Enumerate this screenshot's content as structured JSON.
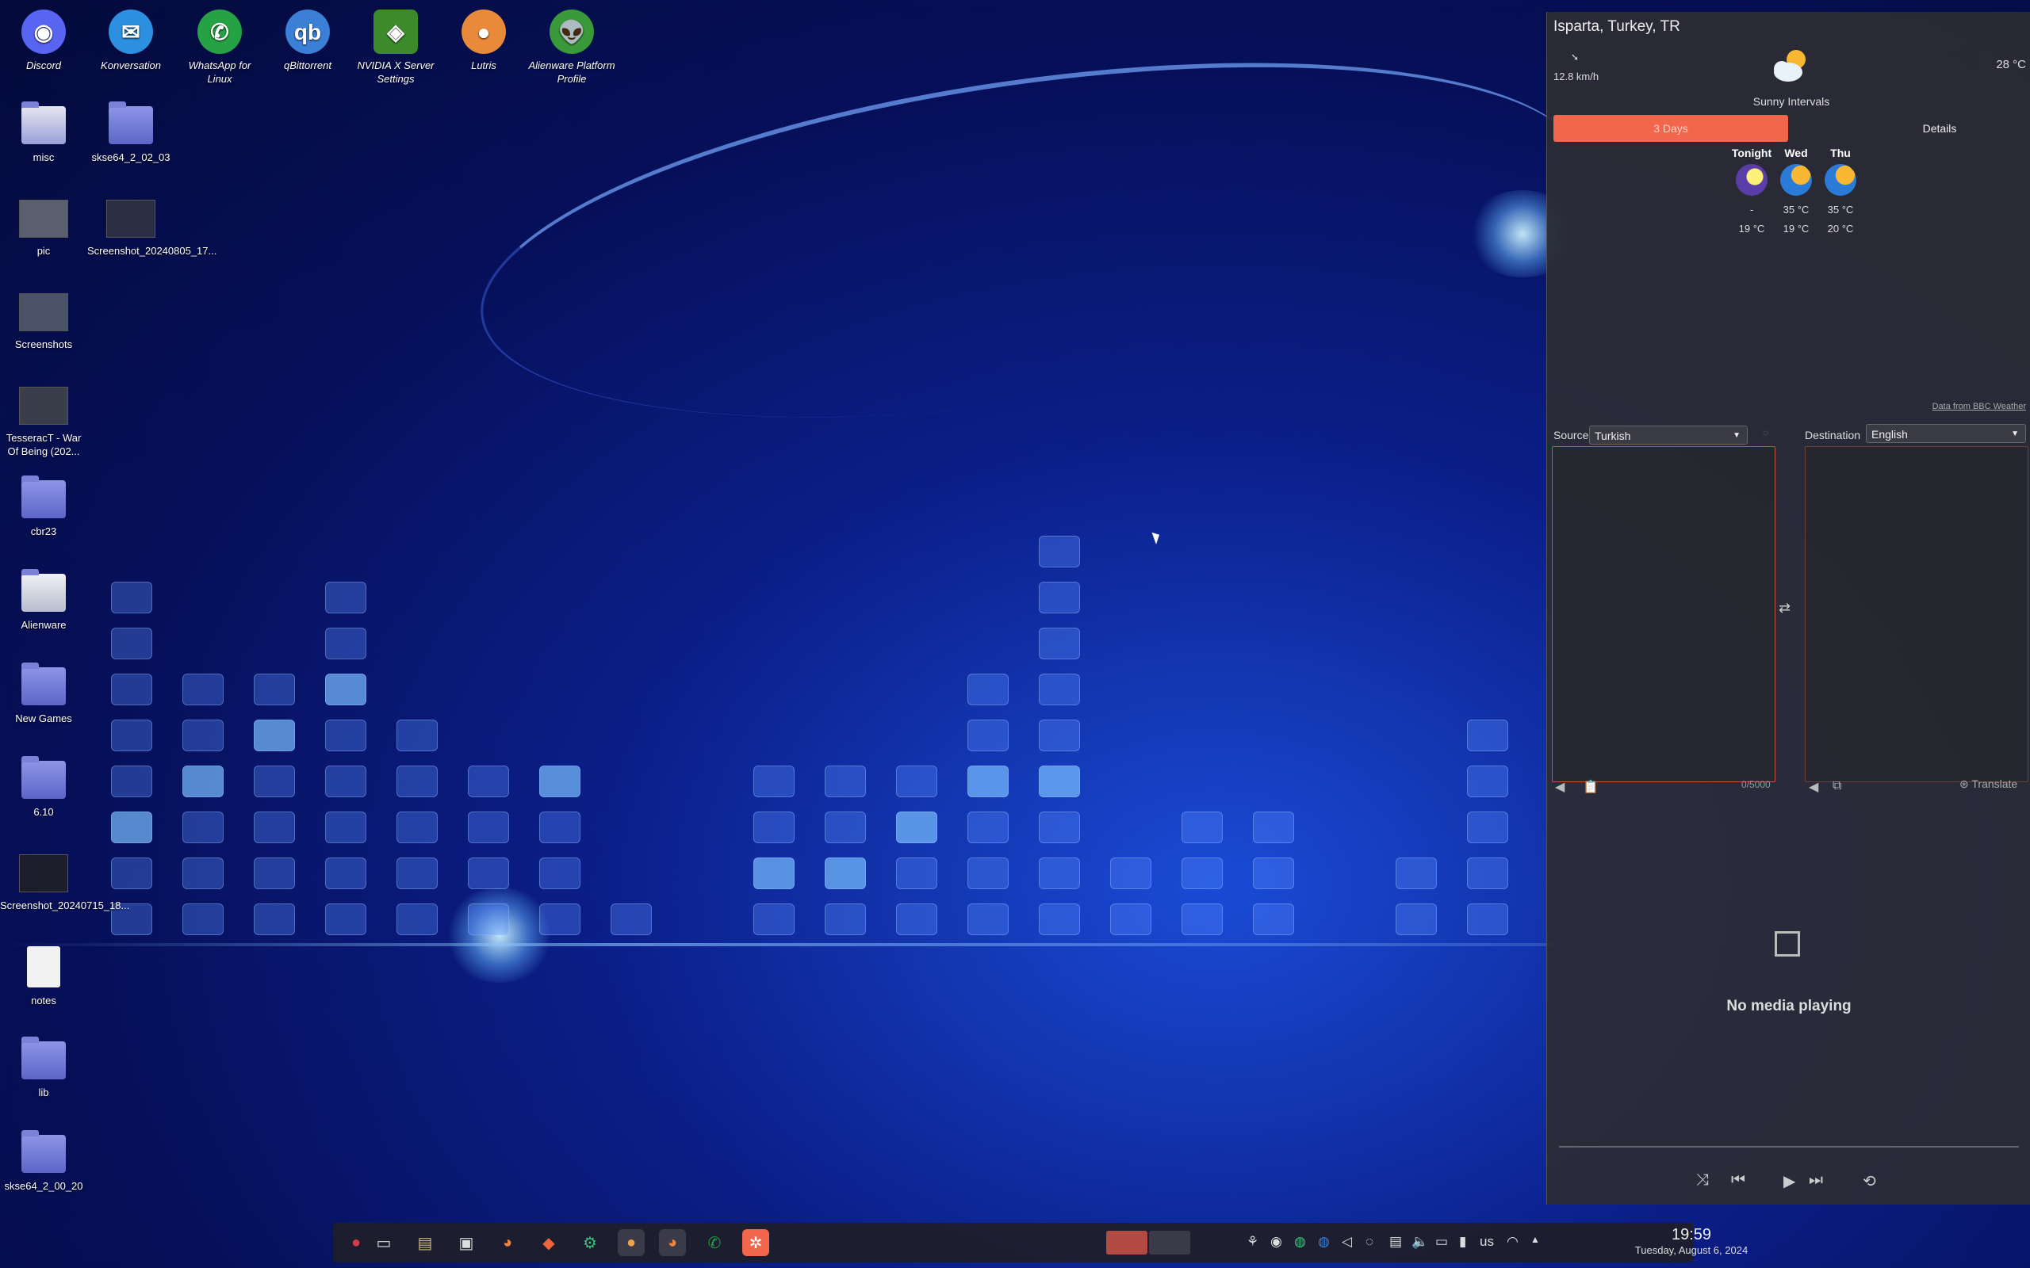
{
  "desktop_icons": [
    {
      "label": "Discord"
    },
    {
      "label": "Konversation"
    },
    {
      "label": "WhatsApp for Linux"
    },
    {
      "label": "qBittorrent"
    },
    {
      "label": "NVIDIA X Server Settings"
    },
    {
      "label": "Lutris"
    },
    {
      "label": "Alienware Platform Profile"
    },
    {
      "label": "misc"
    },
    {
      "label": "skse64_2_02_03"
    },
    {
      "label": "pic"
    },
    {
      "label": "Screenshot_20240805_17..."
    },
    {
      "label": "Screenshots"
    },
    {
      "label": "TesseracT - War Of Being (202..."
    },
    {
      "label": "cbr23"
    },
    {
      "label": "Alienware"
    },
    {
      "label": "New Games"
    },
    {
      "label": "6.10"
    },
    {
      "label": "Screenshot_20240715_18..."
    },
    {
      "label": "notes"
    },
    {
      "label": "lib"
    },
    {
      "label": "skse64_2_00_20"
    }
  ],
  "weather": {
    "location": "Isparta, Turkey, TR",
    "wind": "12.8 km/h",
    "current_temp": "28 °C",
    "condition": "Sunny Intervals",
    "tab_3days": "3 Days",
    "tab_details": "Details",
    "forecast": [
      {
        "day": "Tonight",
        "high": "-",
        "low": "19 °C"
      },
      {
        "day": "Wed",
        "high": "35 °C",
        "low": "19 °C"
      },
      {
        "day": "Thu",
        "high": "35 °C",
        "low": "20 °C"
      }
    ],
    "credit": "Data from BBC Weather"
  },
  "translator": {
    "source_label": "Source",
    "source_value": "Turkish",
    "dest_label": "Destination",
    "dest_value": "English",
    "count": "0/5000",
    "translate_label": "Translate"
  },
  "media": {
    "status": "No media playing"
  },
  "clock": {
    "time": "19:59",
    "date": "Tuesday, August 6, 2024"
  },
  "tray": {
    "keyboard_layout": "us"
  }
}
